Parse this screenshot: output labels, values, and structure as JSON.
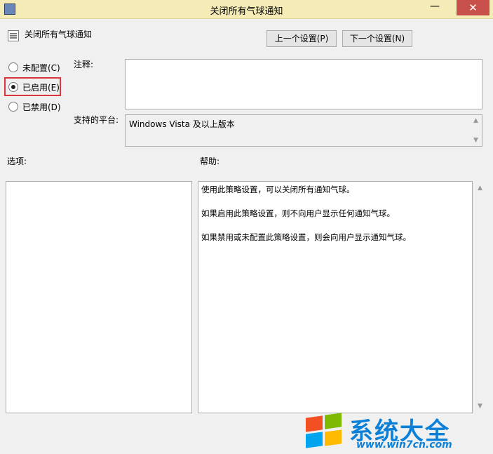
{
  "window": {
    "title": "关闭所有气球通知",
    "minimize": "—",
    "maximize": "□",
    "close": "✕"
  },
  "header": {
    "policy_name": "关闭所有气球通知",
    "prev_button": "上一个设置(P)",
    "next_button": "下一个设置(N)"
  },
  "state": {
    "options": [
      {
        "label": "未配置(C)",
        "checked": false
      },
      {
        "label": "已启用(E)",
        "checked": true
      },
      {
        "label": "已禁用(D)",
        "checked": false
      }
    ]
  },
  "fields": {
    "comment_label": "注释:",
    "comment_value": "",
    "platform_label": "支持的平台:",
    "platform_value": "Windows Vista 及以上版本"
  },
  "sections": {
    "options_label": "选项:",
    "help_label": "帮助:"
  },
  "help": {
    "paragraphs": [
      "使用此策略设置，可以关闭所有通知气球。",
      "如果启用此策略设置，则不向用户显示任何通知气球。",
      "如果禁用或未配置此策略设置，则会向用户显示通知气球。"
    ]
  },
  "watermark": {
    "title": "系统大全",
    "url": "www.win7cn.com"
  },
  "colors": {
    "titlebar": "#f5ebb7",
    "close_button": "#c7504b",
    "highlight": "#d9363e",
    "watermark": "#0a80d8"
  }
}
